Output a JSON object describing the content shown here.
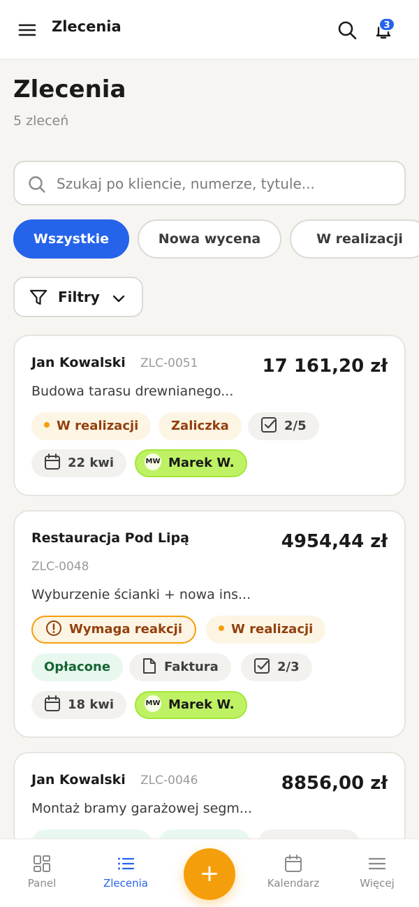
{
  "header": {
    "title": "Zlecenia",
    "notification_count": "3"
  },
  "page": {
    "title": "Zlecenia",
    "count_label": "5 zleceń"
  },
  "search": {
    "placeholder": "Szukaj po kliencie, numerze, tytule..."
  },
  "tabs": [
    {
      "label": "Wszystkie",
      "active": true
    },
    {
      "label": "Nowa wycena",
      "active": false
    },
    {
      "label": "W realizacji",
      "active": false
    }
  ],
  "filters": {
    "label": "Filtry"
  },
  "orders": [
    {
      "client": "Jan Kowalski",
      "number": "ZLC-0051",
      "amount": "17 161,20 zł",
      "description": "Budowa tarasu drewnianego...",
      "status": "W realizacji",
      "payment": "Zaliczka",
      "tasks": "2/5",
      "date": "22 kwi",
      "assignee_initials": "MW",
      "assignee": "Marek W."
    },
    {
      "client": "Restauracja Pod Lipą",
      "number": "ZLC-0048",
      "amount": "4954,44 zł",
      "description": "Wyburzenie ścianki + nowa ins...",
      "alert": "Wymaga reakcji",
      "status": "W realizacji",
      "payment": "Opłacone",
      "document": "Faktura",
      "tasks": "2/3",
      "date": "18 kwi",
      "assignee_initials": "MW",
      "assignee": "Marek W."
    },
    {
      "client": "Jan Kowalski",
      "number": "ZLC-0046",
      "amount": "8856,00 zł",
      "description": "Montaż bramy garażowej segm..."
    }
  ],
  "nav": {
    "panel": "Panel",
    "orders": "Zlecenia",
    "add": "+",
    "calendar": "Kalendarz",
    "more": "Więcej"
  },
  "colors": {
    "accent": "#2563eb",
    "fab": "#f59e0b",
    "assignee": "#bef264",
    "warning": "#f59e0b"
  }
}
